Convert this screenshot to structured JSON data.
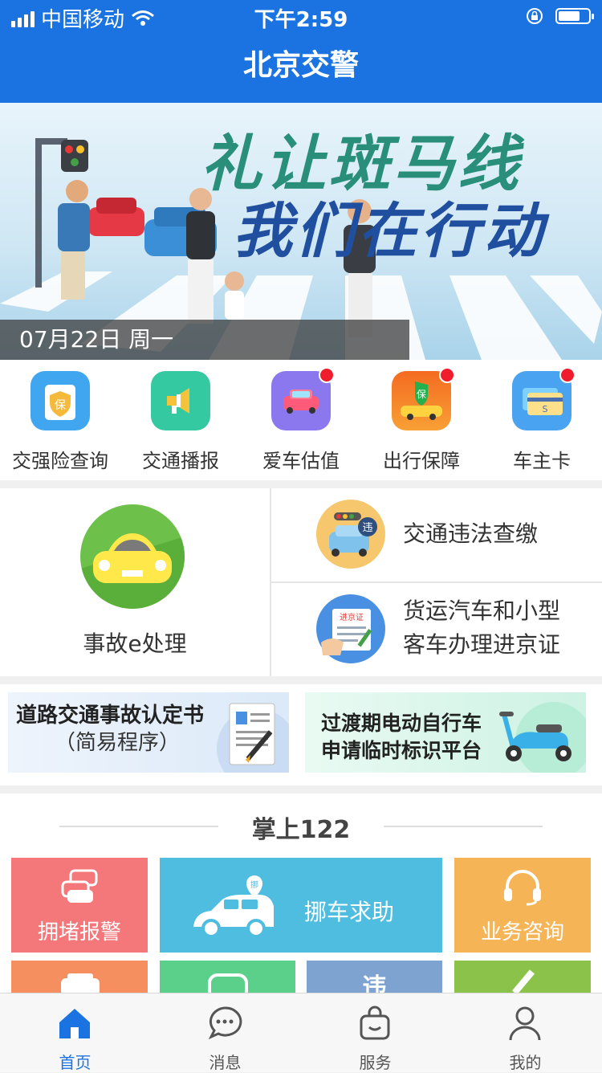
{
  "status_bar": {
    "carrier": "中国移动",
    "time": "下午2:59"
  },
  "nav": {
    "title": "北京交警"
  },
  "banner": {
    "slogan_line1": "礼让斑马线",
    "slogan_line2": "我们在行动",
    "date": "07月22日   周一"
  },
  "quick_services": [
    {
      "label": "交强险查询",
      "icon": "insurance-icon",
      "color": "#3fa6ef",
      "badge": false
    },
    {
      "label": "交通播报",
      "icon": "megaphone-icon",
      "color": "#35c9a1",
      "badge": false
    },
    {
      "label": "爱车估值",
      "icon": "car-valuation-icon",
      "color": "#8c78ee",
      "badge": true
    },
    {
      "label": "出行保障",
      "icon": "travel-protection-icon",
      "color": "#f46b21",
      "badge": true
    },
    {
      "label": "车主卡",
      "icon": "card-icon",
      "color": "#4aa3f0",
      "badge": true
    }
  ],
  "main_services": {
    "accident": "事故e处理",
    "violation": "交通违法查缴",
    "permit_line1": "货运汽车和小型",
    "permit_line2": "客车办理进京证"
  },
  "promos": {
    "left_line1": "道路交通事故认定书",
    "left_line2": "（简易程序）",
    "right_line1": "过渡期电动自行车",
    "right_line2": "申请临时标识平台"
  },
  "section": {
    "title": "掌上122",
    "tiles": [
      {
        "label": "拥堵报警",
        "color": "#f4777a"
      },
      {
        "label": "挪车求助",
        "color": "#4fbde0",
        "badge": "挪"
      },
      {
        "label": "业务咨询",
        "color": "#f5b456"
      }
    ],
    "second_row_colors": [
      "#f58f5f",
      "#5bd08a",
      "#7fa3d1",
      "#8bc34a"
    ],
    "second_row_badge": "违"
  },
  "tabbar": [
    {
      "label": "首页",
      "icon": "home-icon",
      "active": true
    },
    {
      "label": "消息",
      "icon": "message-icon",
      "active": false
    },
    {
      "label": "服务",
      "icon": "shopping-bag-icon",
      "active": false
    },
    {
      "label": "我的",
      "icon": "profile-icon",
      "active": false
    }
  ]
}
